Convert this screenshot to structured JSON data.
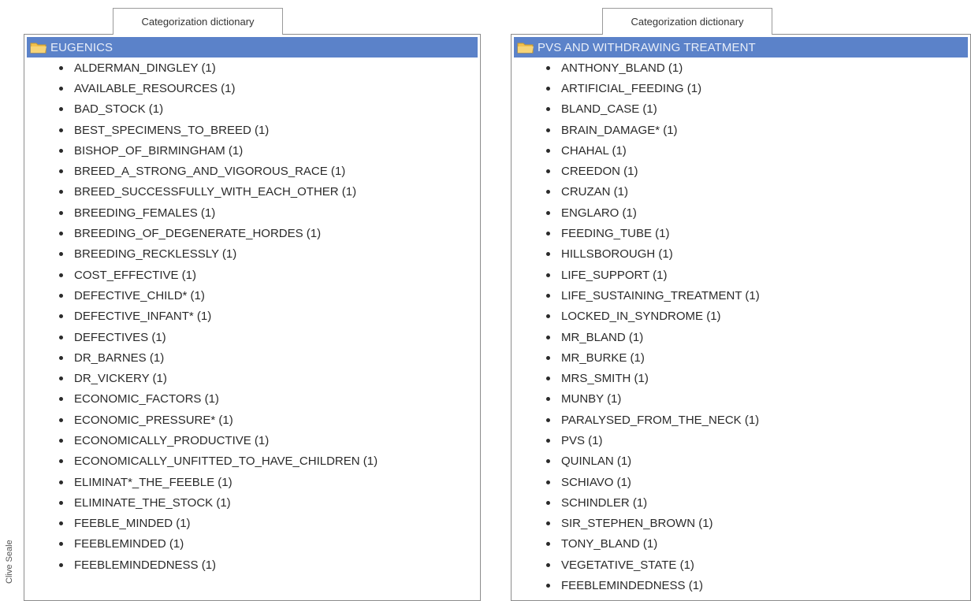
{
  "credit": "Clive Seale",
  "panels": [
    {
      "tab_label": "Categorization dictionary",
      "header": "EUGENICS",
      "items": [
        "ALDERMAN_DINGLEY (1)",
        "AVAILABLE_RESOURCES (1)",
        "BAD_STOCK (1)",
        "BEST_SPECIMENS_TO_BREED (1)",
        "BISHOP_OF_BIRMINGHAM (1)",
        "BREED_A_STRONG_AND_VIGOROUS_RACE (1)",
        "BREED_SUCCESSFULLY_WITH_EACH_OTHER (1)",
        "BREEDING_FEMALES (1)",
        "BREEDING_OF_DEGENERATE_HORDES (1)",
        "BREEDING_RECKLESSLY (1)",
        "COST_EFFECTIVE (1)",
        "DEFECTIVE_CHILD* (1)",
        "DEFECTIVE_INFANT* (1)",
        "DEFECTIVES (1)",
        "DR_BARNES (1)",
        "DR_VICKERY (1)",
        "ECONOMIC_FACTORS (1)",
        "ECONOMIC_PRESSURE* (1)",
        "ECONOMICALLY_PRODUCTIVE (1)",
        "ECONOMICALLY_UNFITTED_TO_HAVE_CHILDREN (1)",
        "ELIMINAT*_THE_FEEBLE (1)",
        "ELIMINATE_THE_STOCK (1)",
        "FEEBLE_MINDED (1)",
        "FEEBLEMINDED (1)",
        "FEEBLEMINDEDNESS (1)"
      ]
    },
    {
      "tab_label": "Categorization dictionary",
      "header": "PVS AND WITHDRAWING TREATMENT",
      "items": [
        "ANTHONY_BLAND (1)",
        "ARTIFICIAL_FEEDING (1)",
        "BLAND_CASE (1)",
        "BRAIN_DAMAGE* (1)",
        "CHAHAL (1)",
        "CREEDON (1)",
        "CRUZAN (1)",
        "ENGLARO (1)",
        "FEEDING_TUBE (1)",
        "HILLSBOROUGH (1)",
        "LIFE_SUPPORT (1)",
        "LIFE_SUSTAINING_TREATMENT (1)",
        "LOCKED_IN_SYNDROME (1)",
        "MR_BLAND (1)",
        "MR_BURKE (1)",
        "MRS_SMITH (1)",
        "MUNBY (1)",
        "PARALYSED_FROM_THE_NECK (1)",
        "PVS (1)",
        "QUINLAN (1)",
        "SCHIAVO (1)",
        "SCHINDLER (1)",
        "SIR_STEPHEN_BROWN (1)",
        "TONY_BLAND (1)",
        "VEGETATIVE_STATE (1)",
        "FEEBLEMINDEDNESS (1)"
      ]
    }
  ],
  "colors": {
    "header_bg": "#5b82c9",
    "header_text": "#e8eef9",
    "folder": "#f2c14e"
  },
  "icons": {
    "folder": "folder-icon",
    "bullet": "bullet"
  }
}
